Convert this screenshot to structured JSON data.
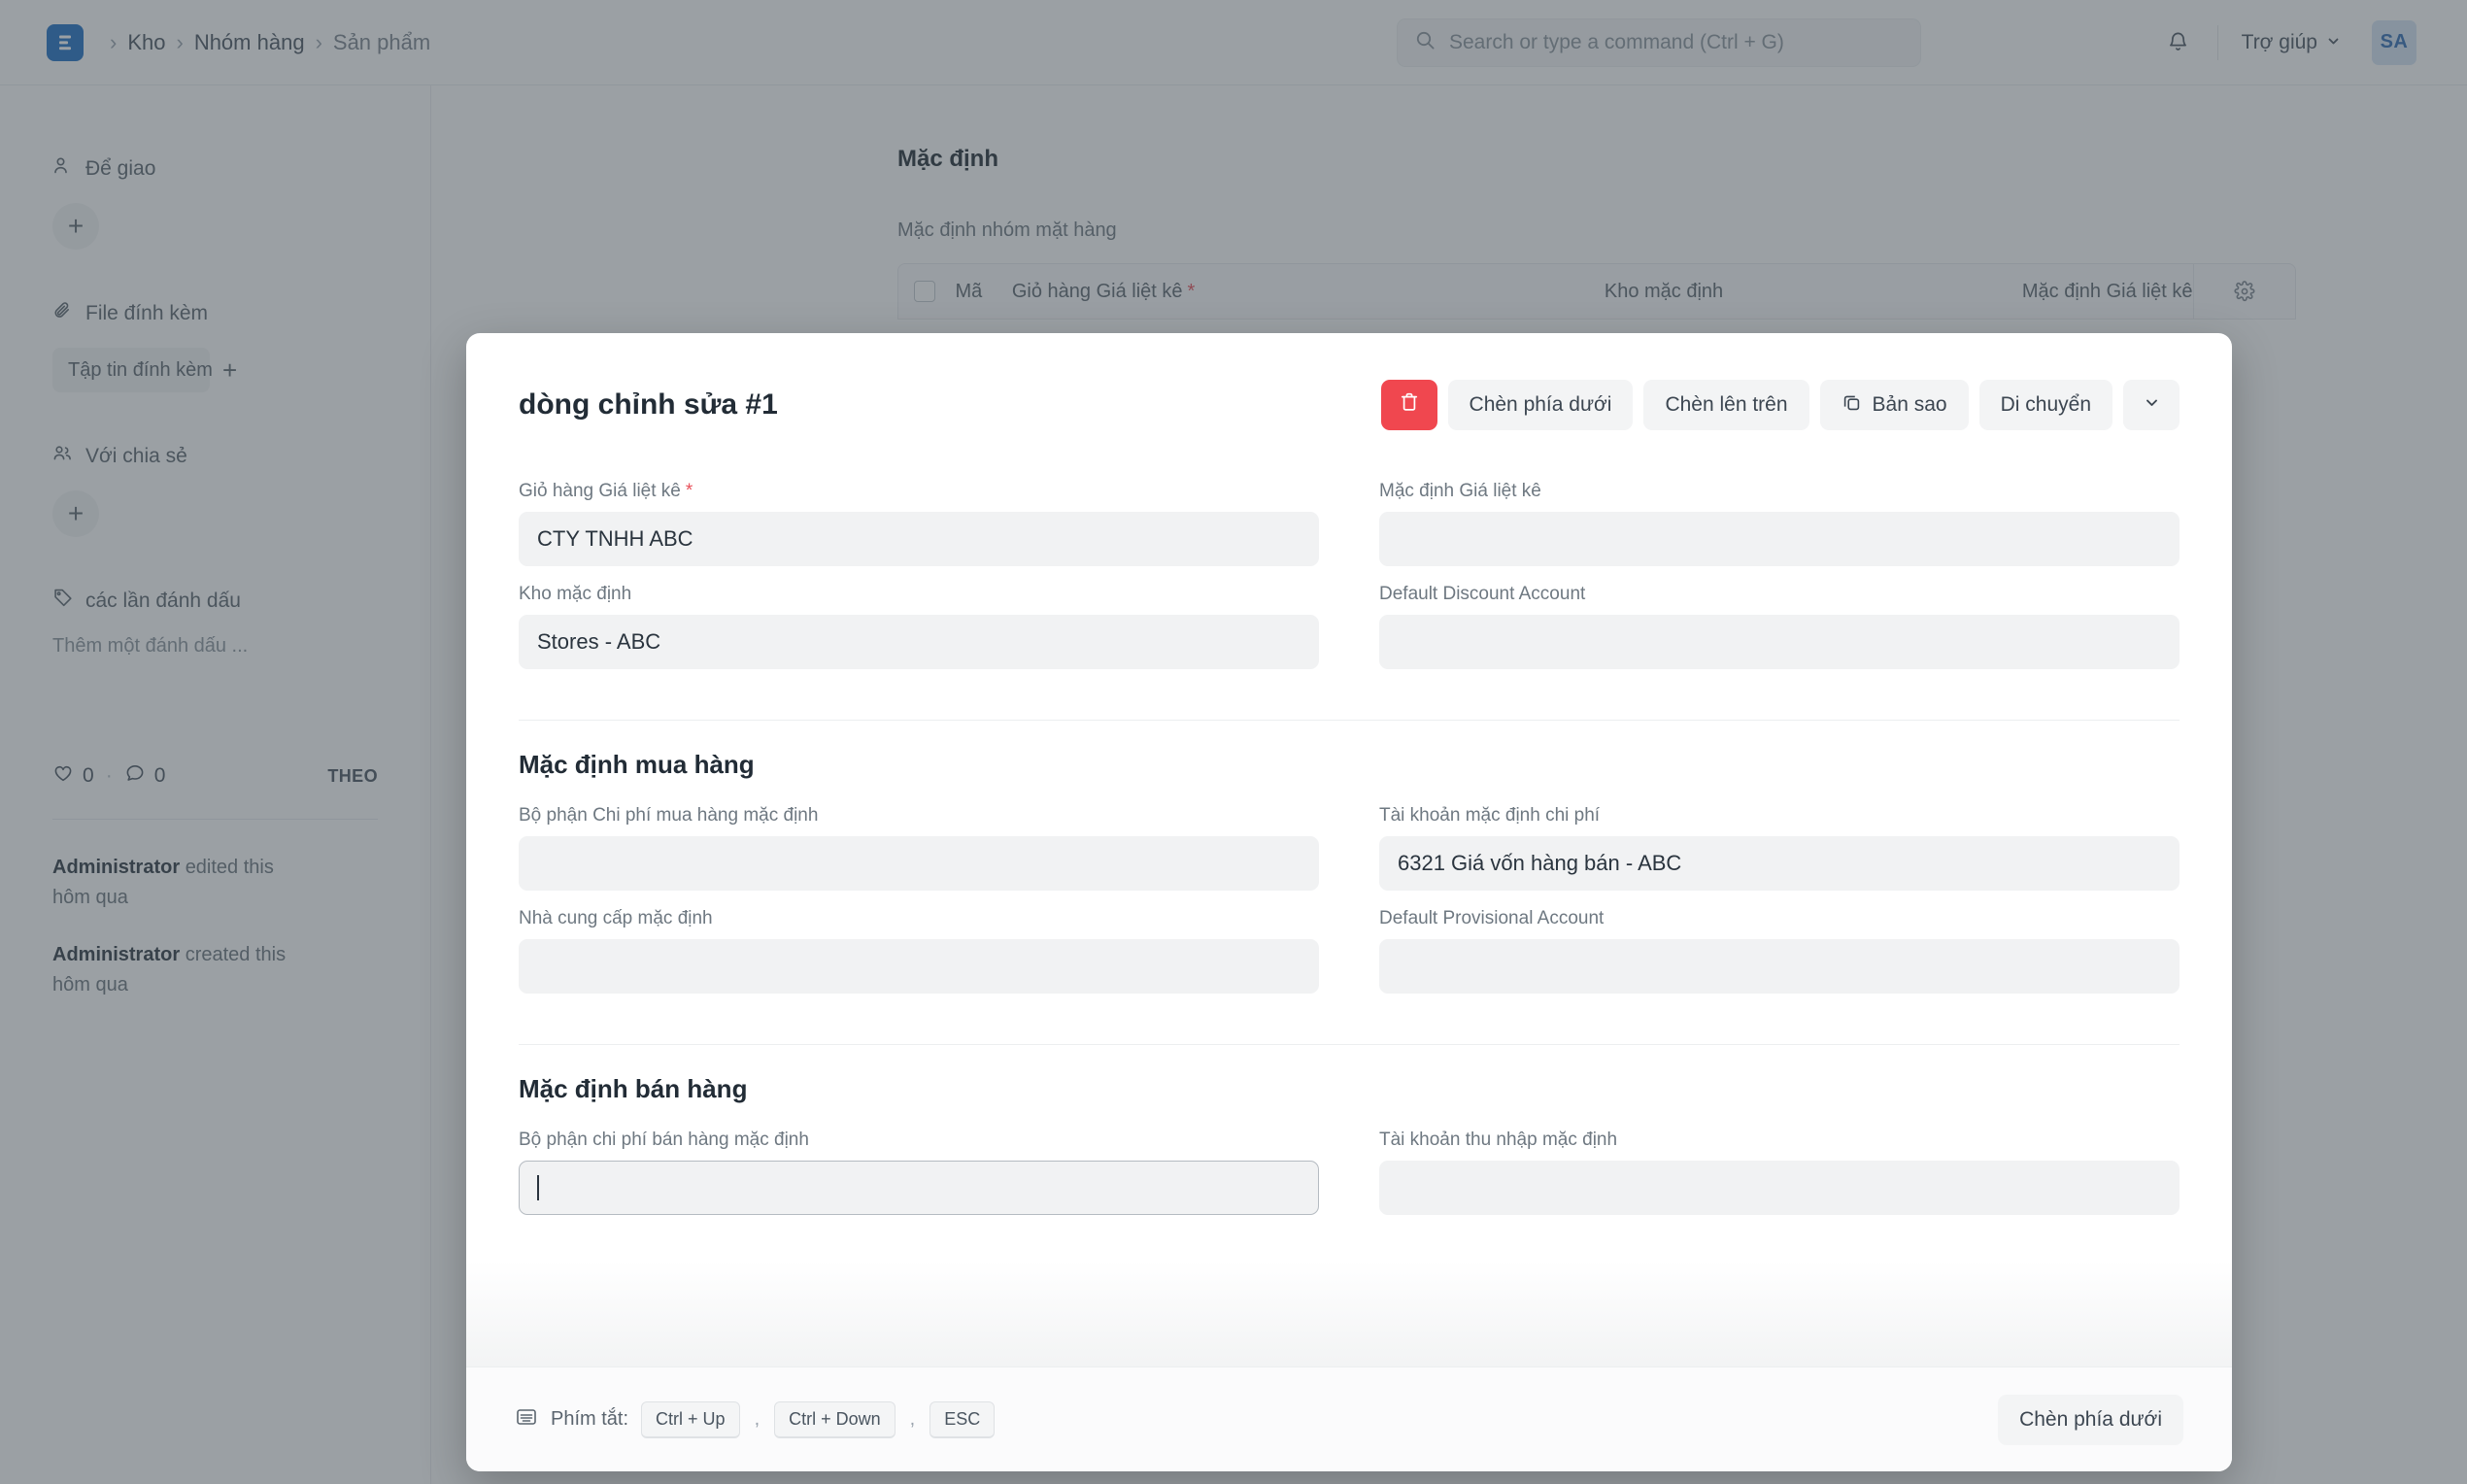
{
  "navbar": {
    "logo_icon": "erpnext-logo-icon",
    "breadcrumbs": [
      "Kho",
      "Nhóm hàng",
      "Sản phẩm"
    ],
    "separator": "›",
    "search": {
      "icon": "search-icon",
      "placeholder": "Search or type a command (Ctrl + G)",
      "value": ""
    },
    "bell_icon": "notification-bell-icon",
    "help_label": "Trợ giúp",
    "help_chevron_icon": "chevron-down-icon",
    "avatar_initials": "SA"
  },
  "sidebar": {
    "assigned": {
      "icon": "user-assign-icon",
      "label": "Để giao",
      "add_icon": "plus-icon"
    },
    "attachments": {
      "icon": "paperclip-icon",
      "label": "File đính kèm",
      "button_label": "Tập tin đính kèm",
      "add_icon": "plus-icon"
    },
    "shared": {
      "icon": "users-share-icon",
      "label": "Với chia sẻ",
      "add_icon": "plus-icon"
    },
    "tags": {
      "icon": "tag-icon",
      "label": "các lần đánh dấu",
      "add_label": "Thêm một đánh dấu ..."
    },
    "stats": {
      "like_icon": "heart-icon",
      "like_count": "0",
      "dot": "·",
      "comment_icon": "comment-icon",
      "comment_count": "0",
      "follow_label": "THEO"
    },
    "activity": [
      {
        "user": "Administrator",
        "action": "edited this",
        "time": "hôm qua"
      },
      {
        "user": "Administrator",
        "action": "created this",
        "time": "hôm qua"
      }
    ]
  },
  "main": {
    "title": "Mặc định",
    "subtitle": "Mặc định nhóm mặt hàng",
    "table_headers": {
      "checkbox": "",
      "code": "Mã",
      "col1": "Giỏ hàng Giá liệt kê",
      "col1_required": "*",
      "col2": "Kho mặc định",
      "col3": "Mặc định Giá liệt kê",
      "settings_icon": "gear-icon"
    }
  },
  "modal": {
    "title": "dòng chỉnh sửa #1",
    "actions": {
      "delete_icon": "trash-icon",
      "insert_below": "Chèn phía dưới",
      "insert_above": "Chèn lên trên",
      "duplicate_icon": "copy-icon",
      "duplicate": "Bản sao",
      "move": "Di chuyển",
      "more_icon": "chevron-down-icon"
    },
    "sections": [
      {
        "title": "",
        "fields_left": [
          {
            "label": "Giỏ hàng Giá liệt kê",
            "required": "*",
            "value": "CTY TNHH ABC",
            "focused": false
          },
          {
            "label": "Kho mặc định",
            "required": "",
            "value": "Stores - ABC",
            "focused": false
          }
        ],
        "fields_right": [
          {
            "label": "Mặc định Giá liệt kê",
            "required": "",
            "value": "",
            "focused": false
          },
          {
            "label": "Default Discount Account",
            "required": "",
            "value": "",
            "focused": false
          }
        ]
      },
      {
        "title": "Mặc định mua hàng",
        "fields_left": [
          {
            "label": "Bộ phận Chi phí mua hàng mặc định",
            "required": "",
            "value": "",
            "focused": false
          },
          {
            "label": "Nhà cung cấp mặc định",
            "required": "",
            "value": "",
            "focused": false
          }
        ],
        "fields_right": [
          {
            "label": "Tài khoản mặc định chi phí",
            "required": "",
            "value": "6321 Giá vốn hàng bán - ABC",
            "focused": false
          },
          {
            "label": "Default Provisional Account",
            "required": "",
            "value": "",
            "focused": false
          }
        ]
      },
      {
        "title": "Mặc định bán hàng",
        "fields_left": [
          {
            "label": "Bộ phận chi phí bán hàng mặc định",
            "required": "",
            "value": "",
            "focused": true
          }
        ],
        "fields_right": [
          {
            "label": "Tài khoản thu nhập mặc định",
            "required": "",
            "value": "",
            "focused": false
          }
        ]
      }
    ],
    "footer": {
      "icon": "keyboard-icon",
      "label": "Phím tắt:",
      "keys": [
        "Ctrl + Up",
        "Ctrl + Down",
        "ESC"
      ],
      "separator": ",",
      "action_label": "Chèn phía dưới"
    }
  },
  "colors": {
    "brand_blue": "#1f6fc4",
    "danger_red": "#f0474f",
    "required_red": "#e8505a",
    "avatar_bg": "#d6e4f4",
    "avatar_text": "#2f6cb3"
  }
}
